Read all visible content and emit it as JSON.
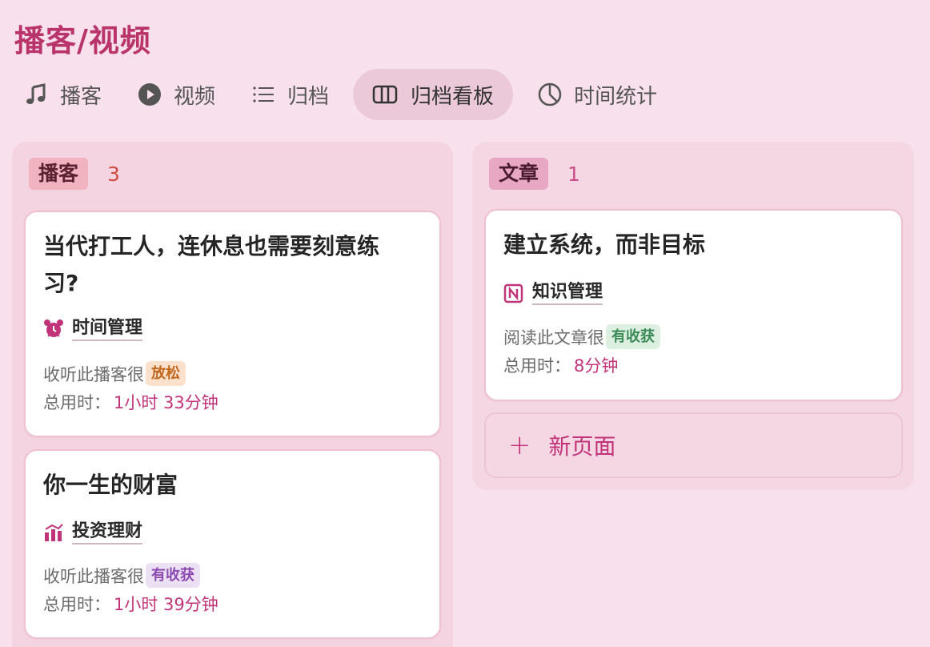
{
  "page": {
    "title": "播客/视频"
  },
  "tabs": [
    {
      "label": "播客",
      "icon": "music-note-icon",
      "active": false
    },
    {
      "label": "视频",
      "icon": "play-circle-icon",
      "active": false
    },
    {
      "label": "归档",
      "icon": "list-icon",
      "active": false
    },
    {
      "label": "归档看板",
      "icon": "board-icon",
      "active": true
    },
    {
      "label": "时间统计",
      "icon": "pie-chart-icon",
      "active": false
    }
  ],
  "columns": [
    {
      "tag": "播客",
      "count": "3",
      "cards": [
        {
          "title": "当代打工人，连休息也需要刻意练习?",
          "relation": {
            "label": "时间管理",
            "icon": "alarm-clock-icon"
          },
          "feeling_prefix": "收听此播客很",
          "feeling": "放松",
          "time_label": "总用时：",
          "time_value": "1小时 33分钟"
        },
        {
          "title": "你一生的财富",
          "relation": {
            "label": "投资理财",
            "icon": "chart-icon"
          },
          "feeling_prefix": "收听此播客很",
          "feeling": "有收获",
          "time_label": "总用时：",
          "time_value": "1小时 39分钟"
        }
      ]
    },
    {
      "tag": "文章",
      "count": "1",
      "cards": [
        {
          "title": "建立系统，而非目标",
          "relation": {
            "label": "知识管理",
            "icon": "notion-logo-icon"
          },
          "feeling_prefix": "阅读此文章很",
          "feeling": "有收获",
          "time_label": "总用时：",
          "time_value": "8分钟"
        }
      ],
      "new_page_label": "新页面"
    }
  ],
  "colors": {
    "background": "#f8e1ec",
    "title": "#b8346a",
    "accent": "#c2347a"
  }
}
